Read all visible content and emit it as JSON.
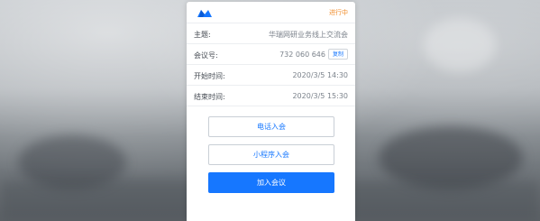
{
  "header": {
    "status": "进行中"
  },
  "details": {
    "topic_label": "主题:",
    "topic_value": "华瑞网研业务线上交流会",
    "meeting_id_label": "会议号:",
    "meeting_id_value": "732 060 646",
    "copy_label": "复制",
    "start_label": "开始时间:",
    "start_value": "2020/3/5 14:30",
    "end_label": "结束时间:",
    "end_value": "2020/3/5 15:30"
  },
  "actions": {
    "phone_join": "电话入会",
    "miniprogram_join": "小程序入会",
    "join_meeting": "加入会议"
  },
  "colors": {
    "accent": "#1677ff",
    "status": "#f08c2b"
  }
}
